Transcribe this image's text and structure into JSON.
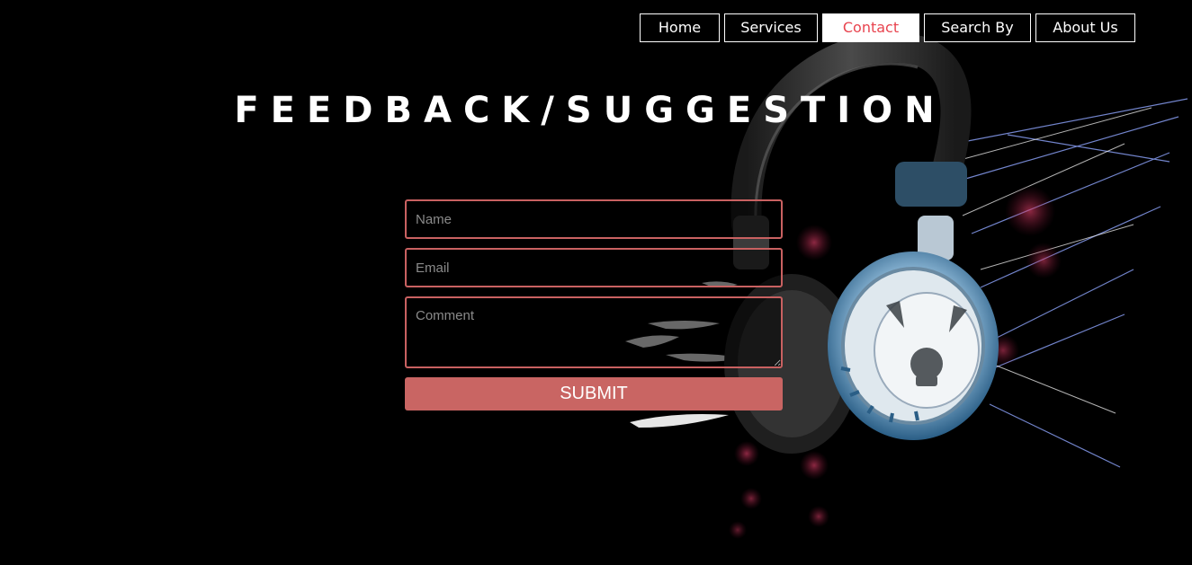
{
  "nav": {
    "items": [
      {
        "label": "Home"
      },
      {
        "label": "Services"
      },
      {
        "label": "Contact"
      },
      {
        "label": "Search By"
      },
      {
        "label": "About Us"
      }
    ],
    "active": "Contact"
  },
  "page": {
    "title": "FEEDBACK/SUGGESTION"
  },
  "form": {
    "name_placeholder": "Name",
    "email_placeholder": "Email",
    "comment_placeholder": "Comment",
    "submit_label": "SUBMIT"
  },
  "colors": {
    "background": "#000000",
    "accent": "#c96563",
    "active_nav_text": "#e8444f"
  },
  "decor": {
    "hero_image": "headphones-with-skull-emblem"
  }
}
